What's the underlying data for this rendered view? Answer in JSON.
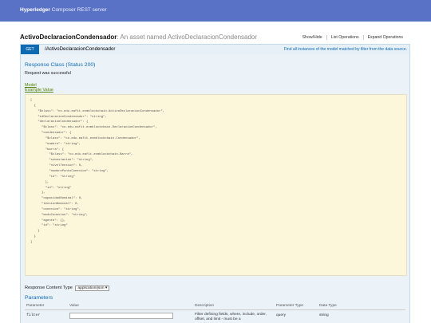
{
  "header": {
    "brand": "Hyperledger",
    "subtitle": "Composer REST server"
  },
  "resource": {
    "name": "ActivoDeclaracionCondensador",
    "description": ": An asset named ActivoDeclaracionCondensador",
    "links": [
      "Show/Hide",
      "List Operations",
      "Expand Operations"
    ]
  },
  "operation": {
    "method": "GET",
    "path": "/ActivoDeclaracionCondensador",
    "summary": "Find all instances of the model matched by filter from the data source."
  },
  "response_class": {
    "title": "Response Class (Status 200)",
    "message": "Request was successful",
    "tab_model": "Model",
    "tab_example": "Example Value",
    "example_lines": [
      "[",
      "  {",
      "    \"$class\": \"co.edu.eafit.evmblockchain.ActivoDeclaracionCondensador\",",
      "    \"idDeclaracionCondensador\": \"string\",",
      "    \"declaracionCondensador\": {",
      "      \"$class\": \"co.edu.eafit.evmblockchain.DeclaracionCondensador\",",
      "      \"condensador\": {",
      "        \"$class\": \"co.edu.eafit.evmblockchain.Condensador\",",
      "        \"nombre\": \"string\",",
      "        \"barra\": {",
      "          \"$class\": \"co.edu.eafit.evmblockchain.Barra\",",
      "          \"subestacion\": \"string\",",
      "          \"nivelTension\": 0,",
      "          \"nombrePuntoConexion\": \"string\",",
      "          \"id\": \"string\"",
      "        },",
      "        \"id\": \"string\"",
      "      },",
      "      \"capacidadNominal\": 0,",
      "      \"tensionNominal\": 0,",
      "      \"conexion\": \"string\",",
      "      \"modoConexion\": \"string\",",
      "      \"agente\": {},",
      "      \"id\": \"string\"",
      "    }",
      "  }",
      "]"
    ]
  },
  "response_content_type": {
    "label": "Response Content Type",
    "selected": "application/json"
  },
  "parameters": {
    "title": "Parameters",
    "headers": [
      "Parameter",
      "Value",
      "Description",
      "Parameter Type",
      "Data Type"
    ],
    "rows": [
      {
        "name": "filter",
        "value": "",
        "description": "Filter defining fields, where, include, order, offset, and limit - must be a",
        "param_type": "query",
        "data_type": "string"
      }
    ]
  }
}
